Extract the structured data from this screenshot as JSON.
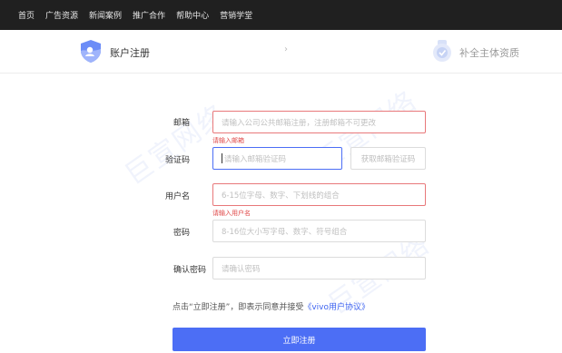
{
  "topnav": {
    "items": [
      "首页",
      "广告资源",
      "新闻案例",
      "推广合作",
      "帮助中心",
      "营销学堂"
    ]
  },
  "steps": {
    "step1_label": "账户注册",
    "arrow": "›",
    "step2_label": "补全主体资质"
  },
  "watermark": "巨宣网络",
  "form": {
    "email": {
      "label": "邮箱",
      "placeholder": "请输入公司公共邮箱注册，注册邮箱不可更改",
      "error": "请输入邮箱"
    },
    "code": {
      "label": "验证码",
      "placeholder": "请输入邮箱验证码",
      "button": "获取邮箱验证码"
    },
    "username": {
      "label": "用户名",
      "placeholder": "6-15位字母、数字、下划线的组合",
      "error": "请输入用户名"
    },
    "password": {
      "label": "密码",
      "placeholder": "8-16位大小写字母、数字、符号组合"
    },
    "confirm": {
      "label": "确认密码",
      "placeholder": "请确认密码"
    },
    "agreement_text": "点击“立即注册”，即表示同意并接受",
    "agreement_link": "《vivo用户协议》",
    "submit": "立即注册"
  },
  "colors": {
    "accent": "#4c6ef5",
    "error": "#e04a4a",
    "nav_bg": "#202020"
  }
}
